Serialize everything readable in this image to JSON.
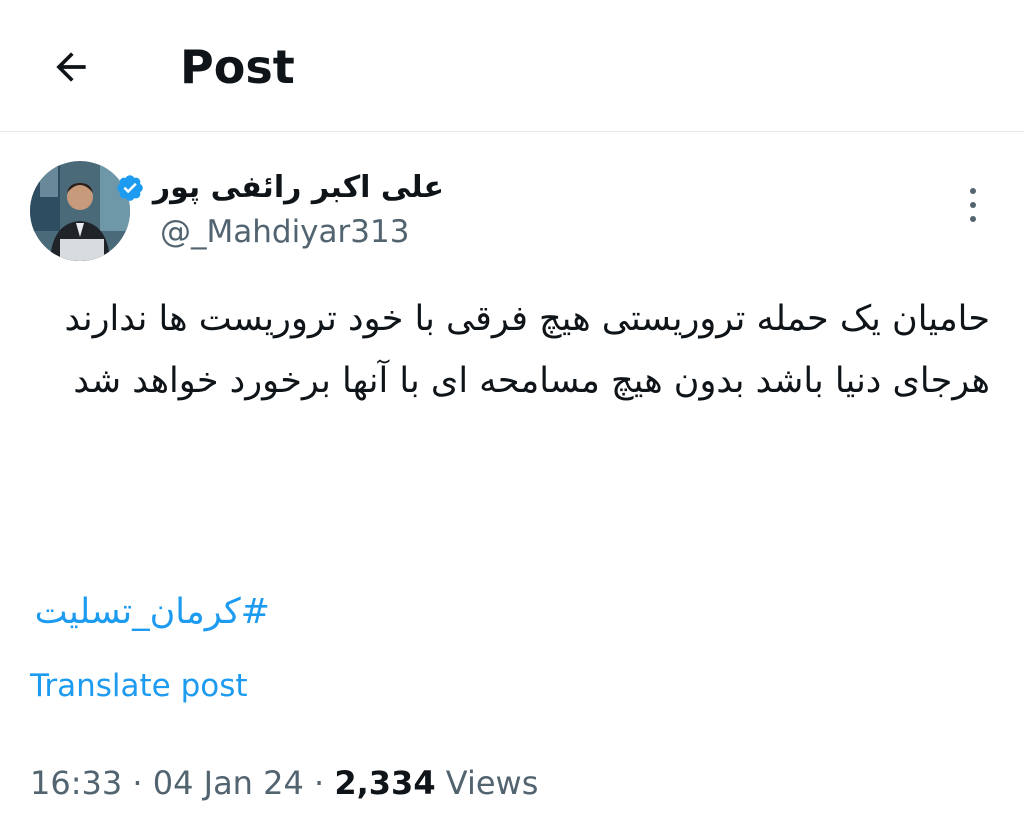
{
  "header": {
    "title": "Post",
    "back_icon": "arrow-left-icon"
  },
  "author": {
    "name": "علی اکبر رائفی پور",
    "handle": "@_Mahdiyar313",
    "verified_icon": "verified-badge-icon",
    "verified_color": "#1d9bf0"
  },
  "more_icon": "more-vertical-icon",
  "tweet": {
    "lines": [
      "حامیان یک حمله تروریستی هیچ فرقی با خود تروریست ها ندارند",
      "هرجای دنیا باشد بدون هیچ مسامحه ای با آنها برخورد خواهد شد"
    ],
    "hashtag": "#کرمان_تسلیت",
    "translate_label": "Translate post"
  },
  "meta": {
    "time": "16:33",
    "sep1": " · ",
    "date": "04 Jan 24",
    "sep2": " · ",
    "views_count": "2,334",
    "views_label": " Views"
  },
  "colors": {
    "accent": "#1d9bf0",
    "secondary_text": "#536471",
    "primary_text": "#0f1419"
  }
}
